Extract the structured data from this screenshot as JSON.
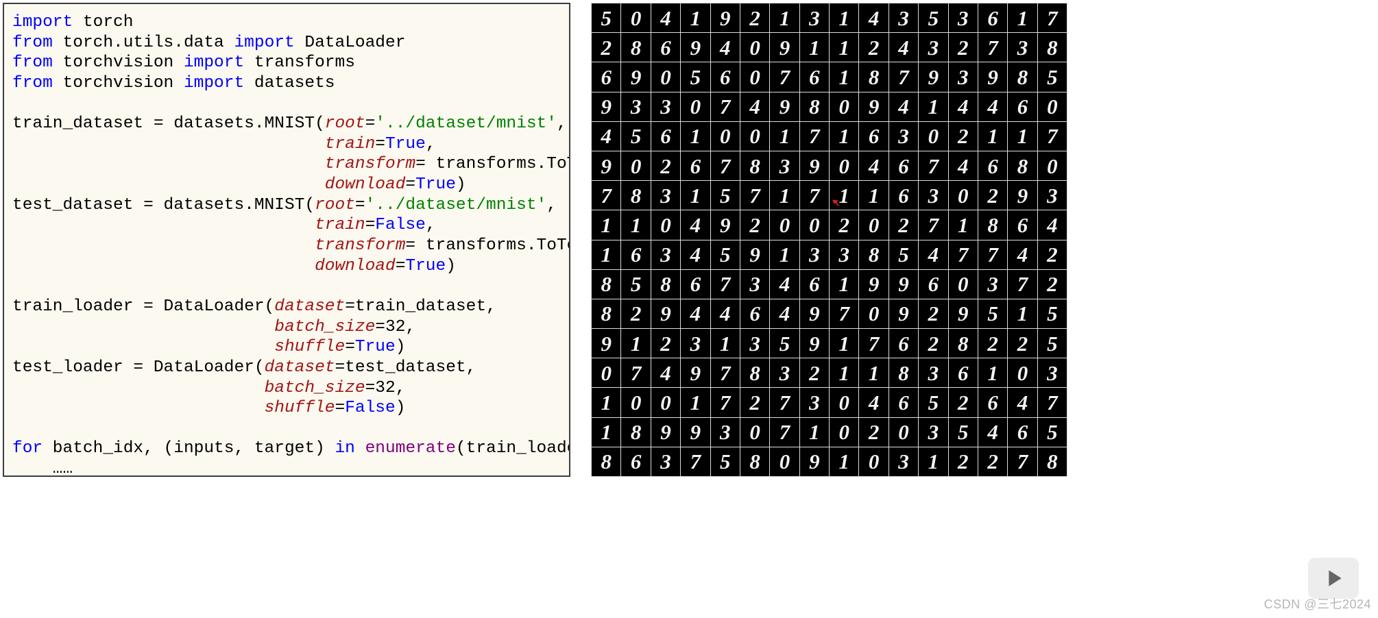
{
  "code": {
    "lines": [
      [
        {
          "cls": "kw",
          "t": "import"
        },
        {
          "cls": "text",
          "t": " torch"
        }
      ],
      [
        {
          "cls": "kw",
          "t": "from"
        },
        {
          "cls": "text",
          "t": " torch.utils.data "
        },
        {
          "cls": "kw",
          "t": "import"
        },
        {
          "cls": "text",
          "t": " DataLoader"
        }
      ],
      [
        {
          "cls": "kw",
          "t": "from"
        },
        {
          "cls": "text",
          "t": " torchvision "
        },
        {
          "cls": "kw",
          "t": "import"
        },
        {
          "cls": "text",
          "t": " transforms"
        }
      ],
      [
        {
          "cls": "kw",
          "t": "from"
        },
        {
          "cls": "text",
          "t": " torchvision "
        },
        {
          "cls": "kw",
          "t": "import"
        },
        {
          "cls": "text",
          "t": " datasets"
        }
      ],
      [
        {
          "cls": "text",
          "t": ""
        }
      ],
      [
        {
          "cls": "text",
          "t": "train_dataset = datasets.MNIST("
        },
        {
          "cls": "param",
          "t": "root"
        },
        {
          "cls": "text",
          "t": "="
        },
        {
          "cls": "str",
          "t": "'../dataset/mnist'"
        },
        {
          "cls": "text",
          "t": ","
        }
      ],
      [
        {
          "cls": "text",
          "t": "                               "
        },
        {
          "cls": "param",
          "t": "train"
        },
        {
          "cls": "text",
          "t": "="
        },
        {
          "cls": "bool",
          "t": "True"
        },
        {
          "cls": "text",
          "t": ","
        }
      ],
      [
        {
          "cls": "text",
          "t": "                               "
        },
        {
          "cls": "param",
          "t": "transform"
        },
        {
          "cls": "text",
          "t": "= transforms.ToTensor(),"
        }
      ],
      [
        {
          "cls": "text",
          "t": "                               "
        },
        {
          "cls": "param",
          "t": "download"
        },
        {
          "cls": "text",
          "t": "="
        },
        {
          "cls": "bool",
          "t": "True"
        },
        {
          "cls": "text",
          "t": ")"
        }
      ],
      [
        {
          "cls": "text",
          "t": "test_dataset = datasets.MNIST("
        },
        {
          "cls": "param",
          "t": "root"
        },
        {
          "cls": "text",
          "t": "="
        },
        {
          "cls": "str",
          "t": "'../dataset/mnist'"
        },
        {
          "cls": "text",
          "t": ","
        }
      ],
      [
        {
          "cls": "text",
          "t": "                              "
        },
        {
          "cls": "param",
          "t": "train"
        },
        {
          "cls": "text",
          "t": "="
        },
        {
          "cls": "bool",
          "t": "False"
        },
        {
          "cls": "text",
          "t": ","
        }
      ],
      [
        {
          "cls": "text",
          "t": "                              "
        },
        {
          "cls": "param",
          "t": "transform"
        },
        {
          "cls": "text",
          "t": "= transforms.ToTensor(),"
        }
      ],
      [
        {
          "cls": "text",
          "t": "                              "
        },
        {
          "cls": "param",
          "t": "download"
        },
        {
          "cls": "text",
          "t": "="
        },
        {
          "cls": "bool",
          "t": "True"
        },
        {
          "cls": "text",
          "t": ")"
        }
      ],
      [
        {
          "cls": "text",
          "t": ""
        }
      ],
      [
        {
          "cls": "text",
          "t": "train_loader = DataLoader("
        },
        {
          "cls": "param",
          "t": "dataset"
        },
        {
          "cls": "text",
          "t": "=train_dataset,"
        }
      ],
      [
        {
          "cls": "text",
          "t": "                          "
        },
        {
          "cls": "param",
          "t": "batch_size"
        },
        {
          "cls": "text",
          "t": "=32,"
        }
      ],
      [
        {
          "cls": "text",
          "t": "                          "
        },
        {
          "cls": "param",
          "t": "shuffle"
        },
        {
          "cls": "text",
          "t": "="
        },
        {
          "cls": "bool",
          "t": "True"
        },
        {
          "cls": "text",
          "t": ")"
        }
      ],
      [
        {
          "cls": "text",
          "t": "test_loader = DataLoader("
        },
        {
          "cls": "param",
          "t": "dataset"
        },
        {
          "cls": "text",
          "t": "=test_dataset,"
        }
      ],
      [
        {
          "cls": "text",
          "t": "                         "
        },
        {
          "cls": "param",
          "t": "batch_size"
        },
        {
          "cls": "text",
          "t": "=32,"
        }
      ],
      [
        {
          "cls": "text",
          "t": "                         "
        },
        {
          "cls": "param",
          "t": "shuffle"
        },
        {
          "cls": "text",
          "t": "="
        },
        {
          "cls": "bool",
          "t": "False"
        },
        {
          "cls": "text",
          "t": ")"
        }
      ],
      [
        {
          "cls": "text",
          "t": ""
        }
      ],
      [
        {
          "cls": "kw",
          "t": "for"
        },
        {
          "cls": "text",
          "t": " batch_idx, (inputs, target) "
        },
        {
          "cls": "kw",
          "t": "in"
        },
        {
          "cls": "text",
          "t": " "
        },
        {
          "cls": "fn",
          "t": "enumerate"
        },
        {
          "cls": "text",
          "t": "(train_loader):"
        }
      ],
      [
        {
          "cls": "text",
          "t": "    ……"
        }
      ]
    ]
  },
  "mnist_grid": [
    [
      "5",
      "0",
      "4",
      "1",
      "9",
      "2",
      "1",
      "3",
      "1",
      "4",
      "3",
      "5",
      "3",
      "6",
      "1",
      "7"
    ],
    [
      "2",
      "8",
      "6",
      "9",
      "4",
      "0",
      "9",
      "1",
      "1",
      "2",
      "4",
      "3",
      "2",
      "7",
      "3",
      "8"
    ],
    [
      "6",
      "9",
      "0",
      "5",
      "6",
      "0",
      "7",
      "6",
      "1",
      "8",
      "7",
      "9",
      "3",
      "9",
      "8",
      "5"
    ],
    [
      "9",
      "3",
      "3",
      "0",
      "7",
      "4",
      "9",
      "8",
      "0",
      "9",
      "4",
      "1",
      "4",
      "4",
      "6",
      "0"
    ],
    [
      "4",
      "5",
      "6",
      "1",
      "0",
      "0",
      "1",
      "7",
      "1",
      "6",
      "3",
      "0",
      "2",
      "1",
      "1",
      "7"
    ],
    [
      "9",
      "0",
      "2",
      "6",
      "7",
      "8",
      "3",
      "9",
      "0",
      "4",
      "6",
      "7",
      "4",
      "6",
      "8",
      "0"
    ],
    [
      "7",
      "8",
      "3",
      "1",
      "5",
      "7",
      "1",
      "7",
      "1",
      "1",
      "6",
      "3",
      "0",
      "2",
      "9",
      "3"
    ],
    [
      "1",
      "1",
      "0",
      "4",
      "9",
      "2",
      "0",
      "0",
      "2",
      "0",
      "2",
      "7",
      "1",
      "8",
      "6",
      "4"
    ],
    [
      "1",
      "6",
      "3",
      "4",
      "5",
      "9",
      "1",
      "3",
      "3",
      "8",
      "5",
      "4",
      "7",
      "7",
      "4",
      "2"
    ],
    [
      "8",
      "5",
      "8",
      "6",
      "7",
      "3",
      "4",
      "6",
      "1",
      "9",
      "9",
      "6",
      "0",
      "3",
      "7",
      "2"
    ],
    [
      "8",
      "2",
      "9",
      "4",
      "4",
      "6",
      "4",
      "9",
      "7",
      "0",
      "9",
      "2",
      "9",
      "5",
      "1",
      "5"
    ],
    [
      "9",
      "1",
      "2",
      "3",
      "1",
      "3",
      "5",
      "9",
      "1",
      "7",
      "6",
      "2",
      "8",
      "2",
      "2",
      "5"
    ],
    [
      "0",
      "7",
      "4",
      "9",
      "7",
      "8",
      "3",
      "2",
      "1",
      "1",
      "8",
      "3",
      "6",
      "1",
      "0",
      "3"
    ],
    [
      "1",
      "0",
      "0",
      "1",
      "7",
      "2",
      "7",
      "3",
      "0",
      "4",
      "6",
      "5",
      "2",
      "6",
      "4",
      "7"
    ],
    [
      "1",
      "8",
      "9",
      "9",
      "3",
      "0",
      "7",
      "1",
      "0",
      "2",
      "0",
      "3",
      "5",
      "4",
      "6",
      "5"
    ],
    [
      "8",
      "6",
      "3",
      "7",
      "5",
      "8",
      "0",
      "9",
      "1",
      "0",
      "3",
      "1",
      "2",
      "2",
      "7",
      "8"
    ]
  ],
  "watermark": "CSDN @三七2024"
}
